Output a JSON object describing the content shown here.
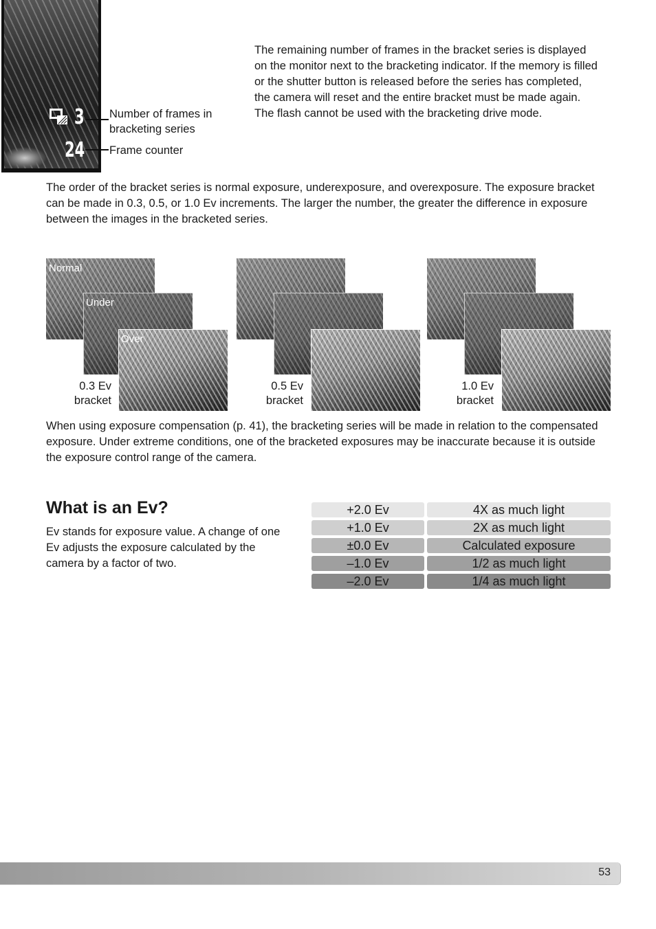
{
  "monitor": {
    "frames_remaining": "3",
    "frame_counter": "24",
    "icon": "bracketing-drive-icon",
    "callouts": {
      "frames_label": "Number of frames in bracketing series",
      "counter_label": "Frame counter"
    }
  },
  "intro_paragraph": "The remaining number of frames in the bracket series is displayed on the monitor next to the bracketing indicator. If the memory is filled or the shutter button is released before the series has completed, the camera will reset and the entire bracket must be made again. The flash cannot be used with the bracketing drive mode.",
  "order_paragraph": "The order of the bracket series is normal exposure, underexposure, and overexposure. The exposure bracket can be made in 0.3, 0.5, or 1.0 Ev increments. The larger the number, the greater the difference in exposure between the images in the bracketed series.",
  "bracket_groups": [
    {
      "caption_line1": "0.3 Ev",
      "caption_line2": "bracket",
      "labels": [
        "Normal",
        "Under",
        "Over"
      ]
    },
    {
      "caption_line1": "0.5 Ev",
      "caption_line2": "bracket",
      "labels": [
        "",
        "",
        ""
      ]
    },
    {
      "caption_line1": "1.0 Ev",
      "caption_line2": "bracket",
      "labels": [
        "",
        "",
        ""
      ]
    }
  ],
  "compensation_paragraph": "When using exposure compensation (p. 41), the bracketing series will be made in relation to the compensated exposure. Under extreme conditions, one of the bracketed exposures may be inaccurate because it is outside the exposure control range of the camera.",
  "ev_section": {
    "title": "What is an Ev?",
    "description": "Ev stands for exposure value. A change of one Ev adjusts the exposure calculated by the camera by a factor of two.",
    "table": [
      {
        "ev": "+2.0 Ev",
        "meaning": "4X as much light",
        "color": "#e6e6e6"
      },
      {
        "ev": "+1.0 Ev",
        "meaning": "2X as much light",
        "color": "#cfcfcf"
      },
      {
        "ev": "±0.0 Ev",
        "meaning": "Calculated exposure",
        "color": "#b6b6b6"
      },
      {
        "ev": "–1.0 Ev",
        "meaning": "1/2 as much light",
        "color": "#9f9f9f"
      },
      {
        "ev": "–2.0 Ev",
        "meaning": "1/4 as much light",
        "color": "#8a8a8a"
      }
    ]
  },
  "footer": {
    "page_number": "53"
  }
}
